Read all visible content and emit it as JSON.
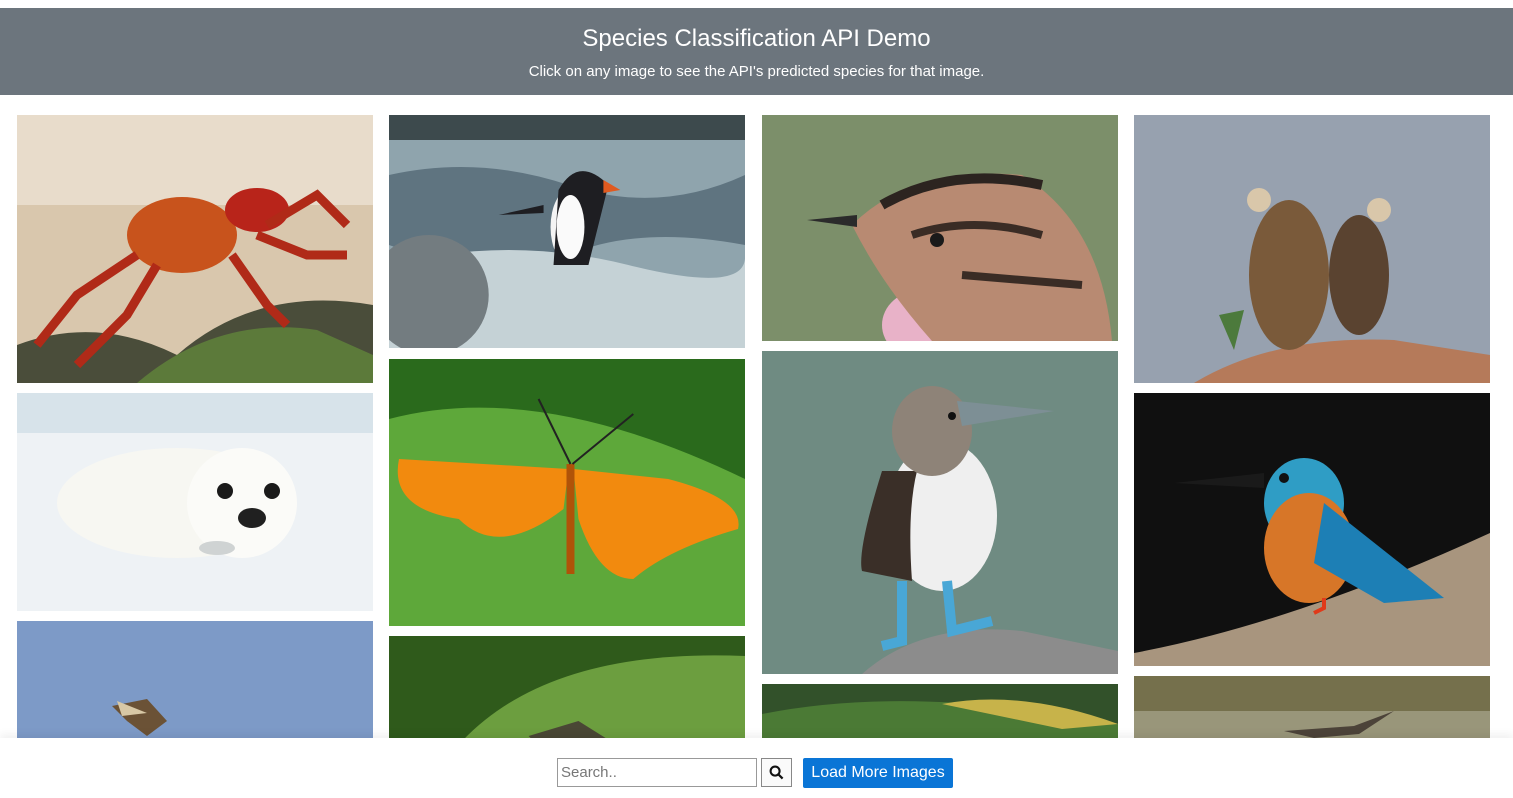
{
  "header": {
    "title": "Species Classification API Demo",
    "subtitle": "Click on any image to see the API's predicted species for that image."
  },
  "gallery": {
    "images": [
      {
        "subject": "red crab on rock"
      },
      {
        "subject": "harp seal pup on snow"
      },
      {
        "subject": "hawk in blue sky"
      },
      {
        "subject": "penguin in water"
      },
      {
        "subject": "orange butterfly on leaf"
      },
      {
        "subject": "insect on green leaf"
      },
      {
        "subject": "streaked sparrow portrait"
      },
      {
        "subject": "blue-footed booby"
      },
      {
        "subject": "bird in foliage"
      },
      {
        "subject": "two vultures on rock"
      },
      {
        "subject": "kingfisher on rock"
      },
      {
        "subject": "bird in flight over field"
      }
    ]
  },
  "footer": {
    "search_placeholder": "Search..",
    "load_more_label": "Load More Images",
    "search_icon": "search-icon"
  }
}
